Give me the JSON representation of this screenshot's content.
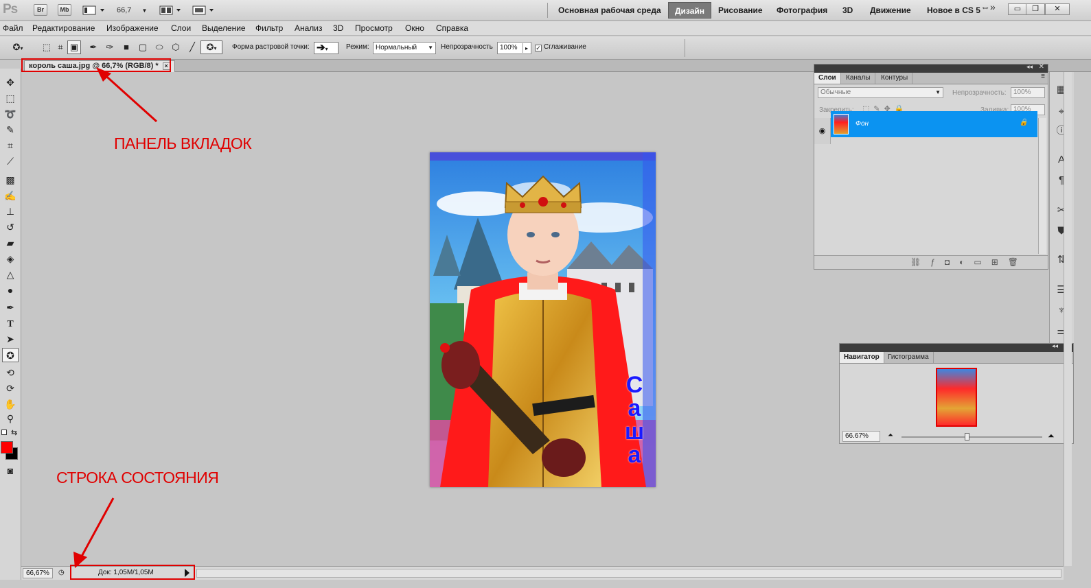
{
  "app": {
    "logo": "Ps",
    "bridge": "Br",
    "minibridge": "Mb",
    "zoom": "66,7",
    "workspaces": [
      "Основная рабочая среда",
      "Дизайн",
      "Рисование",
      "Фотография",
      "3D",
      "Движение",
      "Новое в CS 5"
    ],
    "active_workspace": "Дизайн",
    "window_buttons": [
      "minimize",
      "restore",
      "close"
    ]
  },
  "menu": [
    "Файл",
    "Редактирование",
    "Изображение",
    "Слои",
    "Выделение",
    "Фильтр",
    "Анализ",
    "3D",
    "Просмотр",
    "Окно",
    "Справка"
  ],
  "options": {
    "shape_label": "Форма растровой точки:",
    "mode_label": "Режим:",
    "mode_value": "Нормальный",
    "opacity_label": "Непрозрачность",
    "opacity_value": "100%",
    "antialias_label": "Сглаживание",
    "antialias_checked": true
  },
  "document": {
    "tab_title": "король саша.jpg @ 66,7% (RGB/8) *",
    "close_glyph": "×",
    "photo_text": "Саша"
  },
  "status": {
    "zoom": "66,67%",
    "doc_info": "Док: 1,05M/1,05M"
  },
  "layers_panel": {
    "tabs": [
      "Слои",
      "Каналы",
      "Контуры"
    ],
    "blend_mode": "Обычные",
    "opacity_label": "Непрозрачность:",
    "opacity_value": "100%",
    "lock_label": "Закрепить:",
    "fill_label": "Заливка:",
    "fill_value": "100%",
    "layer_name": "Фон"
  },
  "navigator_panel": {
    "tabs": [
      "Навигатор",
      "Гистограмма"
    ],
    "zoom": "66.67%"
  },
  "annotations": {
    "tabs_label": "ПАНЕЛЬ ВКЛАДОК",
    "status_label": "СТРОКА СОСТОЯНИЯ"
  },
  "colors": {
    "foreground": "#ff0000",
    "background": "#000000",
    "annotation": "#e00000",
    "layer_selected": "#0b93f1"
  }
}
